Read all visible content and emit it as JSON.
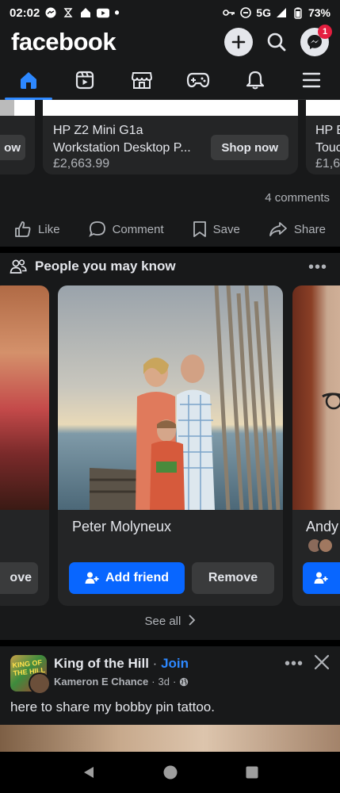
{
  "status_bar": {
    "time": "02:02",
    "network": "5G",
    "battery": "73%"
  },
  "header": {
    "logo": "facebook",
    "messenger_badge": "1"
  },
  "nav_tabs": [
    {
      "name": "home-icon",
      "active": true
    },
    {
      "name": "video-icon",
      "active": false
    },
    {
      "name": "marketplace-icon",
      "active": false
    },
    {
      "name": "gaming-icon",
      "active": false
    },
    {
      "name": "notifications-icon",
      "active": false
    },
    {
      "name": "menu-icon",
      "active": false
    }
  ],
  "products": {
    "left_button_partial": "ow",
    "main": {
      "title_line1": "HP Z2 Mini G1a",
      "title_line2": "Workstation Desktop P...",
      "price": "£2,663.99",
      "button": "Shop now"
    },
    "right": {
      "title_line1": "HP E",
      "title_line2": "Touc",
      "price": "£1,6"
    }
  },
  "post_stats": {
    "comments": "4 comments"
  },
  "actions": {
    "like": "Like",
    "comment": "Comment",
    "save": "Save",
    "share": "Share"
  },
  "pymk": {
    "title": "People you may know",
    "left_card_button": "ove",
    "main_card": {
      "name": "Peter Molyneux",
      "add_label": "Add friend",
      "remove_label": "Remove"
    },
    "right_card": {
      "name": "Andy"
    },
    "see_all": "See all"
  },
  "group_post": {
    "group_name": "King of the Hill",
    "separator": "·",
    "join": "Join",
    "author": "Kameron E Chance",
    "time": "3d",
    "text": "here to share my bobby pin tattoo."
  },
  "colors": {
    "background": "#18191a",
    "card": "#242526",
    "accent_blue": "#0866ff",
    "text_primary": "#e4e6eb",
    "text_secondary": "#b0b3b8"
  }
}
